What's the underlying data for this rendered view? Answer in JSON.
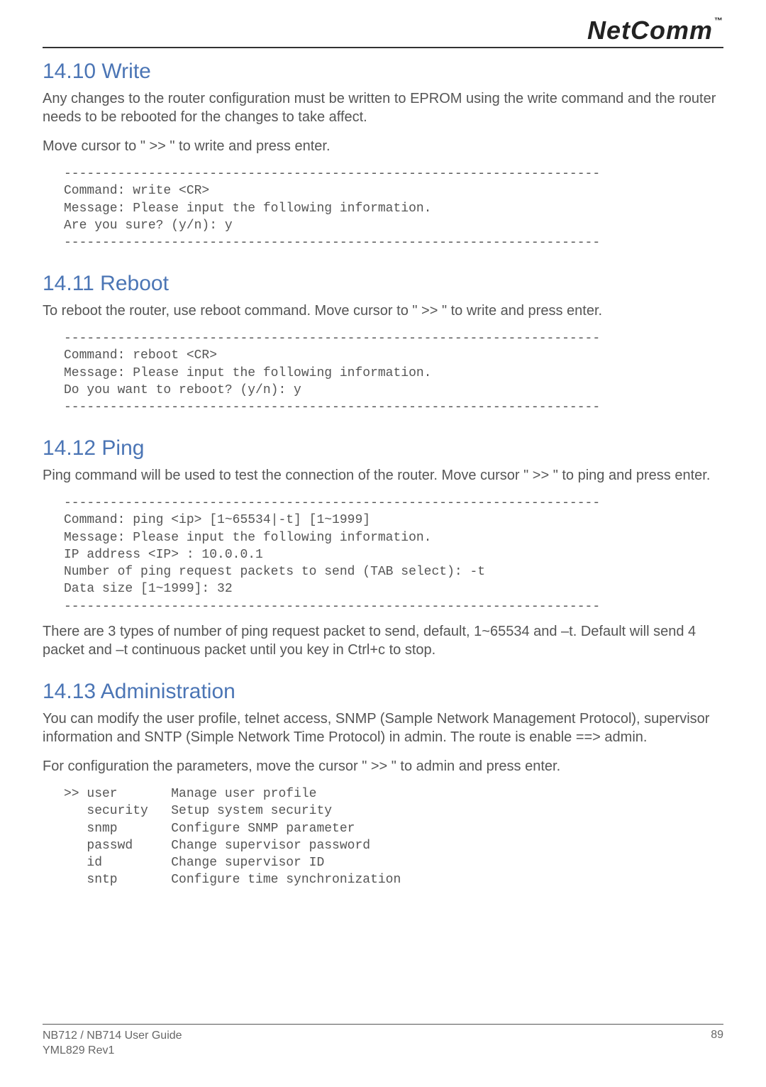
{
  "logo": {
    "brand": "NetComm",
    "tm": "™"
  },
  "sections": {
    "write": {
      "heading": "14.10 Write",
      "p1": "Any changes to the router configuration must be written to EPROM using the write command and the router needs to be rebooted for the changes to take affect.",
      "p2": "Move cursor to \" >> \" to write and press enter.",
      "code": "----------------------------------------------------------------------\nCommand: write <CR>\nMessage: Please input the following information.\nAre you sure? (y/n): y\n----------------------------------------------------------------------"
    },
    "reboot": {
      "heading": "14.11 Reboot",
      "p1": "To reboot the router, use reboot command. Move cursor to \" >> \" to write and press enter.",
      "code": "----------------------------------------------------------------------\nCommand: reboot <CR>\nMessage: Please input the following information.\nDo you want to reboot? (y/n): y\n----------------------------------------------------------------------"
    },
    "ping": {
      "heading": "14.12 Ping",
      "p1": "Ping command will be used to test the connection of the router. Move cursor \" >> \" to ping and press enter.",
      "code": "----------------------------------------------------------------------\nCommand: ping <ip> [1~65534|-t] [1~1999]\nMessage: Please input the following information.\nIP address <IP> : 10.0.0.1\nNumber of ping request packets to send (TAB select): -t\nData size [1~1999]: 32\n----------------------------------------------------------------------",
      "p2": "There are 3 types of number of ping request packet to send, default, 1~65534 and –t. Default will send 4 packet and –t continuous packet until you key in Ctrl+c to stop."
    },
    "admin": {
      "heading": "14.13 Administration",
      "p1": "You can modify the user profile, telnet access, SNMP (Sample Network Management Protocol), supervisor information and SNTP (Simple Network Time Protocol) in admin. The route is enable ==> admin.",
      "p2": "For configuration the parameters, move the cursor \" >> \" to admin and press enter.",
      "code": ">> user       Manage user profile\n   security   Setup system security\n   snmp       Configure SNMP parameter\n   passwd     Change supervisor password\n   id         Change supervisor ID\n   sntp       Configure time synchronization"
    }
  },
  "footer": {
    "left": "NB712 / NB714 User Guide\nYML829 Rev1",
    "right": "89"
  }
}
